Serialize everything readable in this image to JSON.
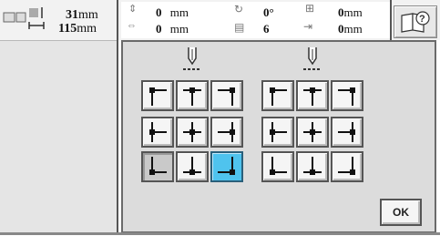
{
  "size": {
    "height": "31",
    "width": "115",
    "unit": "mm"
  },
  "info": {
    "x_move": {
      "value": "0",
      "unit": "mm"
    },
    "y_move": {
      "value": "0",
      "unit": "mm"
    },
    "angle": {
      "value": "0",
      "unit": "°"
    },
    "thread_count": {
      "value": "6"
    },
    "border_h": {
      "value": "0",
      "unit": "mm"
    },
    "border_v": {
      "value": "0",
      "unit": "mm"
    }
  },
  "icons": {
    "size": "pattern-size-icon",
    "help": "help-book-icon",
    "needle": "needle-position-icon"
  },
  "dialog": {
    "ok_label": "OK",
    "group_left_name": "left-needle-group",
    "group_right_name": "right-needle-group"
  },
  "colors": {
    "active_button": "#4fc3ee"
  }
}
